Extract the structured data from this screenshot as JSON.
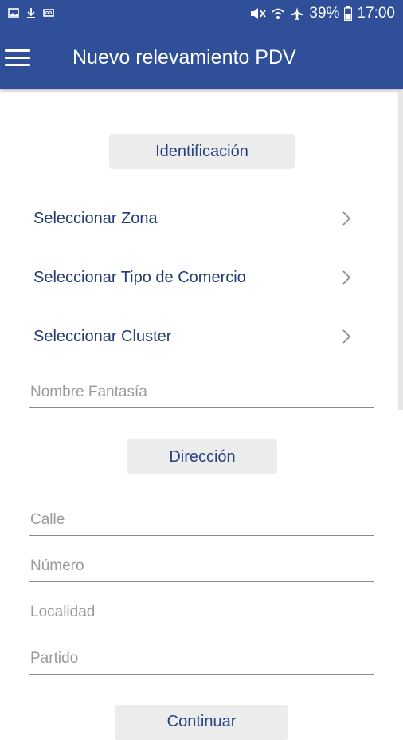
{
  "status_bar": {
    "battery": "39%",
    "time": "17:00"
  },
  "app_bar": {
    "title": "Nuevo relevamiento PDV"
  },
  "sections": {
    "identificacion": "Identificación",
    "direccion": "Dirección",
    "third_partial": "Continuar"
  },
  "selectors": [
    {
      "label": "Seleccionar Zona"
    },
    {
      "label": "Seleccionar Tipo de Comercio"
    },
    {
      "label": "Seleccionar Cluster"
    }
  ],
  "fields": {
    "nombre_fantasia": {
      "placeholder": "Nombre Fantasía",
      "value": ""
    },
    "calle": {
      "placeholder": "Calle",
      "value": ""
    },
    "numero": {
      "placeholder": "Número",
      "value": ""
    },
    "localidad": {
      "placeholder": "Localidad",
      "value": ""
    },
    "partido": {
      "placeholder": "Partido",
      "value": ""
    }
  },
  "colors": {
    "primary": "#2f4f98",
    "text_primary": "#223d73",
    "section_bg": "#ececec"
  },
  "icons": [
    "image-icon",
    "download-icon",
    "voicemail-icon",
    "mute-icon",
    "wifi-icon",
    "airplane-icon",
    "battery-icon",
    "menu-icon",
    "chevron-right-icon"
  ]
}
